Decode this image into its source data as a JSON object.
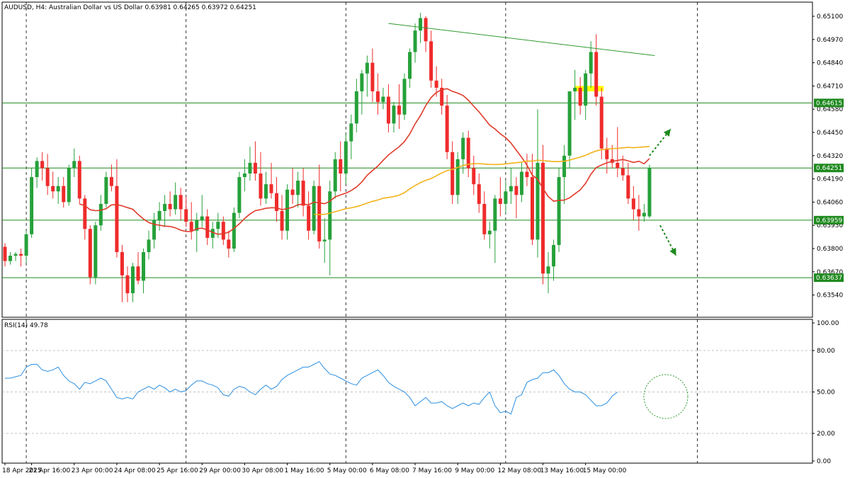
{
  "header": {
    "title": "AUDUSD, H4:  Australian Dollar vs US Dollar  0.63981 0.64265 0.63972 0.64251"
  },
  "rsi_label": "RSI(14) 49.78",
  "colors": {
    "bull": "#26a13a",
    "bear": "#ef2b2b",
    "ma_fast": "#e03a2a",
    "ma_slow": "#f2b21a",
    "rsi": "#2c8fe0",
    "hline": "#1f8a1f",
    "trend": "#2e9a2e",
    "label_bg": "#1f8a1f",
    "highlight": "#ffff00"
  },
  "chart_data": [
    {
      "type": "candlestick",
      "title": "AUDUSD, H4:  Australian Dollar vs US Dollar  0.63981 0.64265 0.63972 0.64251",
      "ylim": [
        0.6342,
        0.6517
      ],
      "price_axis_ticks": [
        "0.65100",
        "0.64970",
        "0.64840",
        "0.64710",
        "0.64580",
        "0.64450",
        "0.64320",
        "0.64190",
        "0.64060",
        "0.63930",
        "0.63800",
        "0.63670",
        "0.63540"
      ],
      "time_axis_ticks": [
        {
          "label": "18 Apr 2025",
          "index": 0
        },
        {
          "label": "21 Apr 16:00",
          "index": 5
        },
        {
          "label": "23 Apr 00:00",
          "index": 13
        },
        {
          "label": "24 Apr 08:00",
          "index": 21
        },
        {
          "label": "25 Apr 16:00",
          "index": 29
        },
        {
          "label": "29 Apr 00:00",
          "index": 37
        },
        {
          "label": "30 Apr 08:00",
          "index": 45
        },
        {
          "label": "1 May 16:00",
          "index": 53
        },
        {
          "label": "5 May 00:00",
          "index": 61
        },
        {
          "label": "6 May 08:00",
          "index": 69
        },
        {
          "label": "7 May 16:00",
          "index": 77
        },
        {
          "label": "9 May 00:00",
          "index": 85
        },
        {
          "label": "12 May 08:00",
          "index": 93
        },
        {
          "label": "13 May 16:00",
          "index": 101
        },
        {
          "label": "15 May 00:00",
          "index": 109
        }
      ],
      "vertical_grid_indices": [
        4,
        34,
        64,
        94,
        130
      ],
      "horizontal_levels": [
        {
          "value": 0.64615,
          "label": "0.64615"
        },
        {
          "value": 0.64251,
          "label": "0.64251"
        },
        {
          "value": 0.63959,
          "label": "0.63959"
        },
        {
          "value": 0.63637,
          "label": "0.63637"
        }
      ],
      "trendline": {
        "from": {
          "index": 72,
          "price": 0.6506
        },
        "to": {
          "index": 122,
          "price": 0.6488
        }
      },
      "highlight_zone": {
        "from_index": 107,
        "to_index": 112,
        "top": 0.6471,
        "bottom": 0.6468
      },
      "arrows": [
        {
          "from": {
            "index": 121,
            "price": 0.6432
          },
          "to": {
            "index": 125,
            "price": 0.6447
          }
        },
        {
          "from": {
            "index": 123,
            "price": 0.6393
          },
          "to": {
            "index": 126,
            "price": 0.6376
          }
        }
      ],
      "candles": [
        [
          0.6381,
          0.6383,
          0.637,
          0.6373
        ],
        [
          0.6373,
          0.6378,
          0.6371,
          0.6376
        ],
        [
          0.6376,
          0.6378,
          0.6373,
          0.6377
        ],
        [
          0.6377,
          0.638,
          0.637,
          0.6376
        ],
        [
          0.6376,
          0.639,
          0.6372,
          0.6388
        ],
        [
          0.6388,
          0.6425,
          0.6386,
          0.642
        ],
        [
          0.642,
          0.6431,
          0.6414,
          0.6429
        ],
        [
          0.6429,
          0.6434,
          0.6418,
          0.6425
        ],
        [
          0.6425,
          0.6433,
          0.641,
          0.6415
        ],
        [
          0.6415,
          0.6423,
          0.6408,
          0.6412
        ],
        [
          0.6412,
          0.642,
          0.6405,
          0.6415
        ],
        [
          0.6415,
          0.642,
          0.6403,
          0.6406
        ],
        [
          0.6406,
          0.6427,
          0.6404,
          0.6425
        ],
        [
          0.6425,
          0.6436,
          0.642,
          0.6429
        ],
        [
          0.6429,
          0.6432,
          0.6405,
          0.6408
        ],
        [
          0.6408,
          0.641,
          0.6385,
          0.6391
        ],
        [
          0.6391,
          0.6393,
          0.636,
          0.6364
        ],
        [
          0.6364,
          0.6395,
          0.636,
          0.6393
        ],
        [
          0.6393,
          0.641,
          0.639,
          0.6405
        ],
        [
          0.6405,
          0.6423,
          0.6403,
          0.642
        ],
        [
          0.642,
          0.6427,
          0.6412,
          0.6415
        ],
        [
          0.6415,
          0.643,
          0.6375,
          0.6378
        ],
        [
          0.6378,
          0.6382,
          0.635,
          0.6365
        ],
        [
          0.6365,
          0.637,
          0.635,
          0.6355
        ],
        [
          0.6355,
          0.6372,
          0.635,
          0.637
        ],
        [
          0.637,
          0.6378,
          0.636,
          0.6362
        ],
        [
          0.6362,
          0.638,
          0.6355,
          0.6378
        ],
        [
          0.6378,
          0.639,
          0.6374,
          0.6385
        ],
        [
          0.6385,
          0.64,
          0.638,
          0.6396
        ],
        [
          0.6396,
          0.6406,
          0.639,
          0.6401
        ],
        [
          0.6401,
          0.641,
          0.6392,
          0.6405
        ],
        [
          0.6405,
          0.6412,
          0.6398,
          0.6402
        ],
        [
          0.6402,
          0.6417,
          0.6399,
          0.641
        ],
        [
          0.641,
          0.6414,
          0.6396,
          0.6402
        ],
        [
          0.6402,
          0.6409,
          0.6392,
          0.6395
        ],
        [
          0.6395,
          0.6406,
          0.6385,
          0.639
        ],
        [
          0.639,
          0.64,
          0.6378,
          0.6396
        ],
        [
          0.6396,
          0.641,
          0.6392,
          0.6398
        ],
        [
          0.6398,
          0.6402,
          0.6382,
          0.6386
        ],
        [
          0.6386,
          0.6395,
          0.638,
          0.6391
        ],
        [
          0.6391,
          0.64,
          0.6386,
          0.6395
        ],
        [
          0.6395,
          0.6398,
          0.6382,
          0.6385
        ],
        [
          0.6385,
          0.639,
          0.6375,
          0.638
        ],
        [
          0.638,
          0.6403,
          0.6378,
          0.64
        ],
        [
          0.64,
          0.6423,
          0.6397,
          0.642
        ],
        [
          0.642,
          0.643,
          0.6412,
          0.6422
        ],
        [
          0.6422,
          0.6437,
          0.6418,
          0.6428
        ],
        [
          0.6428,
          0.644,
          0.6418,
          0.6422
        ],
        [
          0.6422,
          0.6434,
          0.6404,
          0.6408
        ],
        [
          0.6408,
          0.6423,
          0.6405,
          0.6416
        ],
        [
          0.6416,
          0.6428,
          0.6408,
          0.6411
        ],
        [
          0.6411,
          0.642,
          0.6395,
          0.6401
        ],
        [
          0.6401,
          0.641,
          0.6385,
          0.639
        ],
        [
          0.639,
          0.6416,
          0.6385,
          0.6413
        ],
        [
          0.6413,
          0.6425,
          0.6405,
          0.641
        ],
        [
          0.641,
          0.6423,
          0.6403,
          0.6418
        ],
        [
          0.6418,
          0.6425,
          0.6398,
          0.6404
        ],
        [
          0.6404,
          0.6412,
          0.6385,
          0.639
        ],
        [
          0.639,
          0.6418,
          0.6388,
          0.6415
        ],
        [
          0.6415,
          0.6427,
          0.638,
          0.6384
        ],
        [
          0.6384,
          0.6397,
          0.6372,
          0.6385
        ],
        [
          0.6385,
          0.6418,
          0.6365,
          0.6412
        ],
        [
          0.6412,
          0.6434,
          0.6408,
          0.643
        ],
        [
          0.643,
          0.644,
          0.6412,
          0.6422
        ],
        [
          0.6422,
          0.6444,
          0.6416,
          0.644
        ],
        [
          0.644,
          0.6455,
          0.643,
          0.645
        ],
        [
          0.645,
          0.6475,
          0.6445,
          0.6468
        ],
        [
          0.6468,
          0.648,
          0.6455,
          0.6478
        ],
        [
          0.6478,
          0.6488,
          0.6465,
          0.6484
        ],
        [
          0.6484,
          0.6492,
          0.6462,
          0.6468
        ],
        [
          0.6468,
          0.6478,
          0.6455,
          0.6462
        ],
        [
          0.6462,
          0.647,
          0.6458,
          0.6465
        ],
        [
          0.6465,
          0.6472,
          0.6445,
          0.645
        ],
        [
          0.645,
          0.6462,
          0.6445,
          0.646
        ],
        [
          0.646,
          0.6472,
          0.6447,
          0.6455
        ],
        [
          0.6455,
          0.6478,
          0.6452,
          0.6475
        ],
        [
          0.6475,
          0.6492,
          0.647,
          0.649
        ],
        [
          0.649,
          0.6506,
          0.6484,
          0.6502
        ],
        [
          0.6502,
          0.6512,
          0.6495,
          0.6509
        ],
        [
          0.6509,
          0.651,
          0.649,
          0.6496
        ],
        [
          0.6496,
          0.6502,
          0.647,
          0.6474
        ],
        [
          0.6474,
          0.6482,
          0.6465,
          0.647
        ],
        [
          0.647,
          0.6475,
          0.6455,
          0.646
        ],
        [
          0.646,
          0.6466,
          0.643,
          0.6434
        ],
        [
          0.6434,
          0.644,
          0.6405,
          0.641
        ],
        [
          0.641,
          0.6434,
          0.6405,
          0.643
        ],
        [
          0.643,
          0.6445,
          0.6422,
          0.6442
        ],
        [
          0.6442,
          0.6446,
          0.642,
          0.6425
        ],
        [
          0.6425,
          0.6432,
          0.641,
          0.6416
        ],
        [
          0.6416,
          0.6422,
          0.64,
          0.6405
        ],
        [
          0.6405,
          0.6412,
          0.6385,
          0.6388
        ],
        [
          0.6388,
          0.6395,
          0.638,
          0.639
        ],
        [
          0.639,
          0.641,
          0.6372,
          0.6408
        ],
        [
          0.6408,
          0.642,
          0.6398,
          0.6405
        ],
        [
          0.6405,
          0.6418,
          0.64,
          0.6412
        ],
        [
          0.6412,
          0.6425,
          0.6405,
          0.6415
        ],
        [
          0.6415,
          0.642,
          0.6397,
          0.641
        ],
        [
          0.641,
          0.6428,
          0.6406,
          0.6423
        ],
        [
          0.6423,
          0.6433,
          0.6415,
          0.642
        ],
        [
          0.642,
          0.6433,
          0.6382,
          0.6385
        ],
        [
          0.6385,
          0.6458,
          0.6375,
          0.6428
        ],
        [
          0.6428,
          0.6438,
          0.636,
          0.6366
        ],
        [
          0.6366,
          0.6378,
          0.6355,
          0.637
        ],
        [
          0.637,
          0.6385,
          0.6362,
          0.6382
        ],
        [
          0.6382,
          0.6425,
          0.6378,
          0.642
        ],
        [
          0.642,
          0.6438,
          0.6405,
          0.6432
        ],
        [
          0.6432,
          0.6456,
          0.6425,
          0.6468
        ],
        [
          0.6468,
          0.648,
          0.6452,
          0.647
        ],
        [
          0.647,
          0.6476,
          0.6455,
          0.646
        ],
        [
          0.646,
          0.648,
          0.6452,
          0.6478
        ],
        [
          0.6478,
          0.6496,
          0.647,
          0.649
        ],
        [
          0.649,
          0.65,
          0.646,
          0.6465
        ],
        [
          0.6465,
          0.647,
          0.643,
          0.6436
        ],
        [
          0.6436,
          0.6442,
          0.6422,
          0.643
        ],
        [
          0.643,
          0.6438,
          0.6425,
          0.6428
        ],
        [
          0.6428,
          0.6448,
          0.642,
          0.6425
        ],
        [
          0.6425,
          0.6432,
          0.6418,
          0.6421
        ],
        [
          0.6421,
          0.6428,
          0.6405,
          0.6408
        ],
        [
          0.6408,
          0.6415,
          0.6396,
          0.6402
        ],
        [
          0.6402,
          0.641,
          0.639,
          0.6398
        ],
        [
          0.6398,
          0.6405,
          0.6395,
          0.64
        ],
        [
          0.6398,
          0.6427,
          0.6397,
          0.6425
        ]
      ],
      "sma_fast": {
        "name": "",
        "period": 50
      },
      "sma_slow": {
        "name": "",
        "period": 100
      }
    },
    {
      "type": "line",
      "title": "RSI(14) 49.78",
      "ylim": [
        0,
        100
      ],
      "axis_ticks": [
        "100.00",
        "80.00",
        "50.00",
        "20.00",
        "0.00"
      ],
      "levels": [
        80,
        50,
        20
      ],
      "values": [
        60,
        60,
        61,
        62,
        68,
        70,
        70,
        66,
        65,
        66,
        68,
        62,
        58,
        56,
        52,
        57,
        56,
        58,
        60,
        58,
        52,
        46,
        45,
        46,
        45,
        50,
        52,
        54,
        52,
        55,
        53,
        50,
        52,
        50,
        51,
        55,
        58,
        58,
        56,
        55,
        53,
        48,
        47,
        52,
        54,
        53,
        50,
        48,
        52,
        55,
        52,
        54,
        59,
        62,
        64,
        66,
        68,
        68,
        70,
        72,
        67,
        63,
        62,
        60,
        58,
        56,
        55,
        60,
        62,
        64,
        66,
        62,
        57,
        54,
        52,
        50,
        46,
        40,
        43,
        46,
        42,
        42,
        43,
        40,
        38,
        40,
        42,
        40,
        42,
        41,
        46,
        50,
        40,
        35,
        36,
        34,
        46,
        48,
        57,
        59,
        60,
        64,
        64,
        66,
        62,
        56,
        52,
        50,
        50,
        48,
        44,
        40,
        40,
        42,
        47,
        50
      ]
    }
  ]
}
